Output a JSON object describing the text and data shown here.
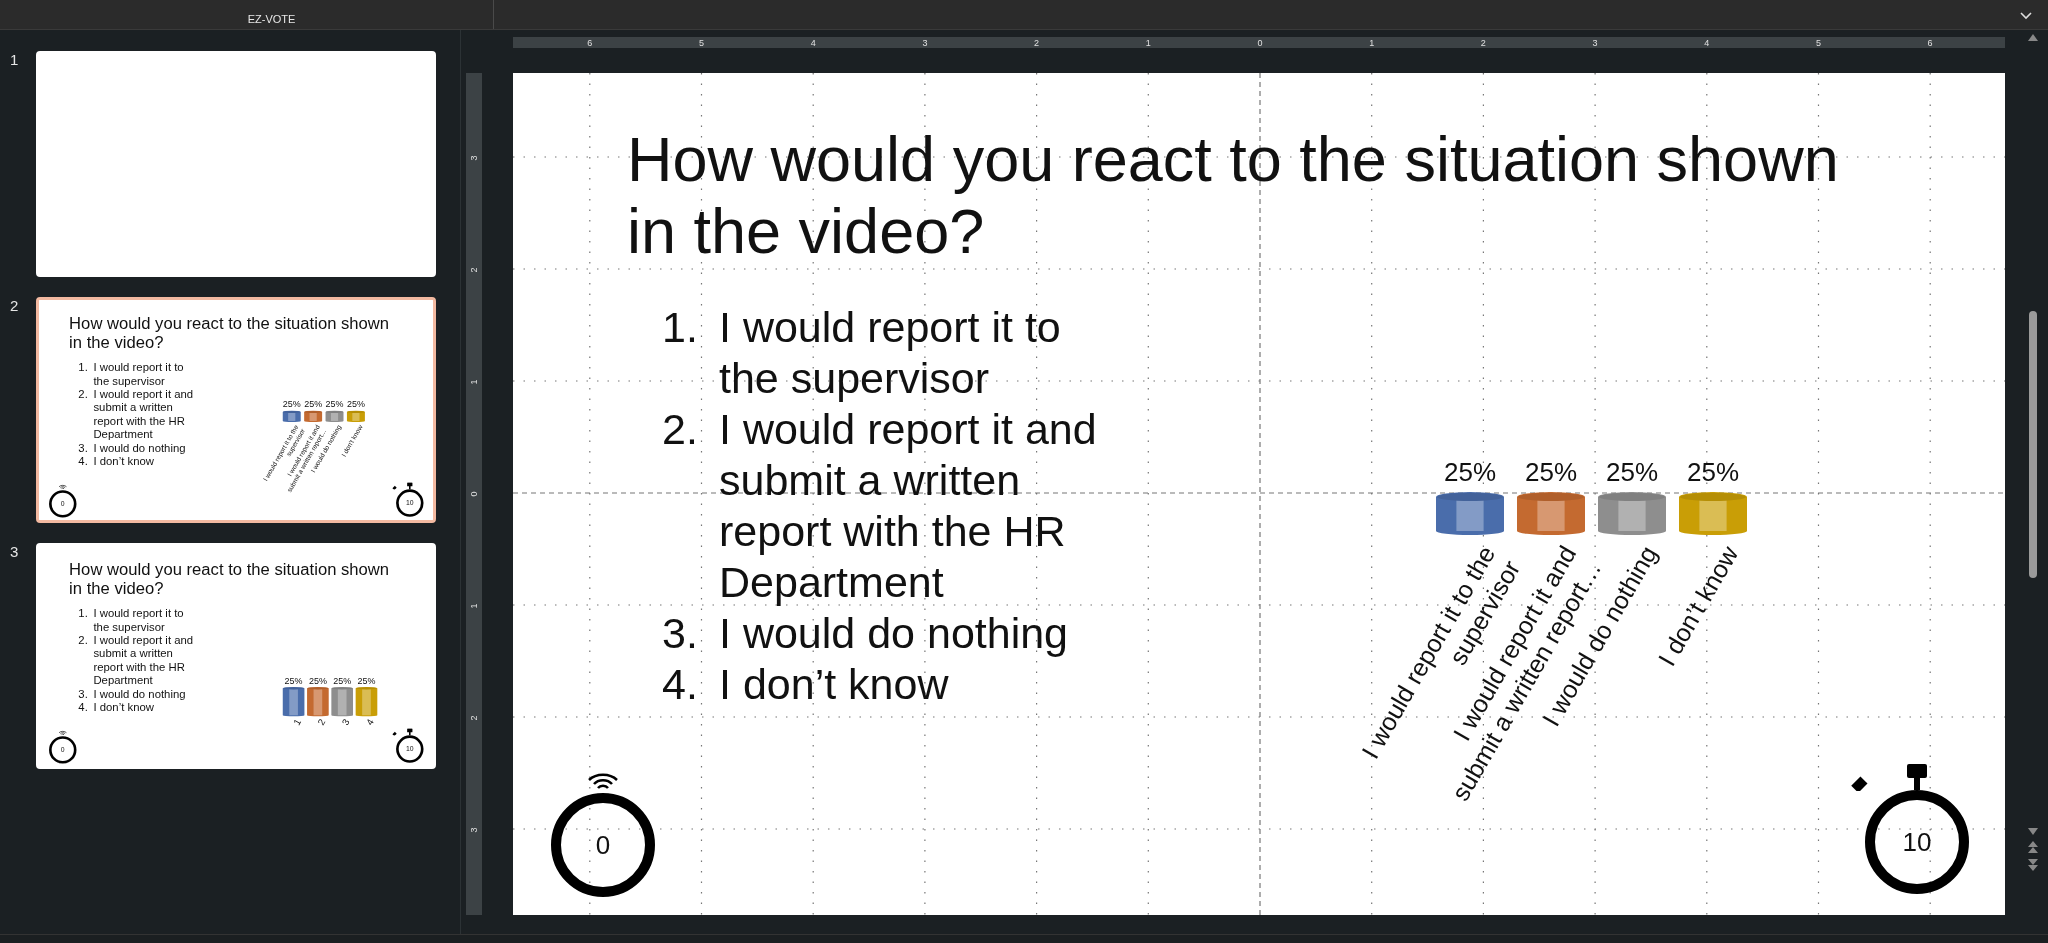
{
  "ribbon": {
    "group_label": "EZ-VOTE"
  },
  "slides": [
    {
      "number": "1",
      "selected": false,
      "kind": "blank"
    },
    {
      "number": "2",
      "selected": true,
      "kind": "poll_labeled",
      "title": "How would you react to the situation shown in the video?",
      "items": [
        {
          "number": "1.",
          "text": "I would report it to the supervisor"
        },
        {
          "number": "2.",
          "text": "I would report it and submit a written report with the HR Department"
        },
        {
          "number": "3.",
          "text": "I would do nothing"
        },
        {
          "number": "4.",
          "text": "I don’t know"
        }
      ],
      "results": [
        {
          "label": "I would report it to the supervisor",
          "result": "25%",
          "color": "#4a6dab"
        },
        {
          "label": "I would report it and submit a written report…",
          "result": "25%",
          "color": "#c46a30"
        },
        {
          "label": "I would do nothing",
          "result": "25%",
          "color": "#8e8e8e"
        },
        {
          "label": "I don’t know",
          "result": "25%",
          "color": "#c99e06"
        }
      ],
      "timers": [
        {
          "kind": "signal",
          "value": "0"
        },
        {
          "kind": "stopwatch",
          "value": "10"
        }
      ]
    },
    {
      "number": "3",
      "selected": false,
      "kind": "poll_numbered",
      "title": "How would you react to the situation shown in the video?",
      "items": [
        {
          "number": "1.",
          "text": "I would report it to the supervisor"
        },
        {
          "number": "2.",
          "text": "I would report it and submit a written report with the HR Department"
        },
        {
          "number": "3.",
          "text": "I would do nothing"
        },
        {
          "number": "4.",
          "text": "I don’t know"
        }
      ],
      "results": [
        {
          "label": "1",
          "result": "25%",
          "color": "#4a6dab"
        },
        {
          "label": "2",
          "result": "25%",
          "color": "#c46a30"
        },
        {
          "label": "3",
          "result": "25%",
          "color": "#8e8e8e"
        },
        {
          "label": "4",
          "result": "25%",
          "color": "#c99e06"
        }
      ],
      "timers": [
        {
          "kind": "signal",
          "value": "0"
        },
        {
          "kind": "stopwatch",
          "value": "10"
        }
      ]
    }
  ],
  "editor": {
    "horizontal_ruler": [
      "6",
      "5",
      "4",
      "3",
      "2",
      "1",
      "0",
      "1",
      "2",
      "3",
      "4",
      "5",
      "6"
    ],
    "vertical_ruler": [
      "3",
      "2",
      "1",
      "0",
      "1",
      "2",
      "3"
    ],
    "slide": {
      "kind": "poll_labeled",
      "title": "How would you react to the situation shown in the video?",
      "items": [
        {
          "number": "1.",
          "text": "I would report it to the supervisor"
        },
        {
          "number": "2.",
          "text": "I would report it and submit a written report with the HR Department"
        },
        {
          "number": "3.",
          "text": "I would do nothing"
        },
        {
          "number": "4.",
          "text": "I don’t know"
        }
      ],
      "results": [
        {
          "label": "I would report it to the supervisor",
          "result": "25%",
          "color": "#4a6dab"
        },
        {
          "label": "I would report it and submit a written report…",
          "result": "25%",
          "color": "#c46a30"
        },
        {
          "label": "I would do nothing",
          "result": "25%",
          "color": "#8e8e8e"
        },
        {
          "label": "I don’t know",
          "result": "25%",
          "color": "#c99e06"
        }
      ],
      "timers": [
        {
          "kind": "signal",
          "value": "0"
        },
        {
          "kind": "stopwatch",
          "value": "10"
        }
      ]
    }
  }
}
